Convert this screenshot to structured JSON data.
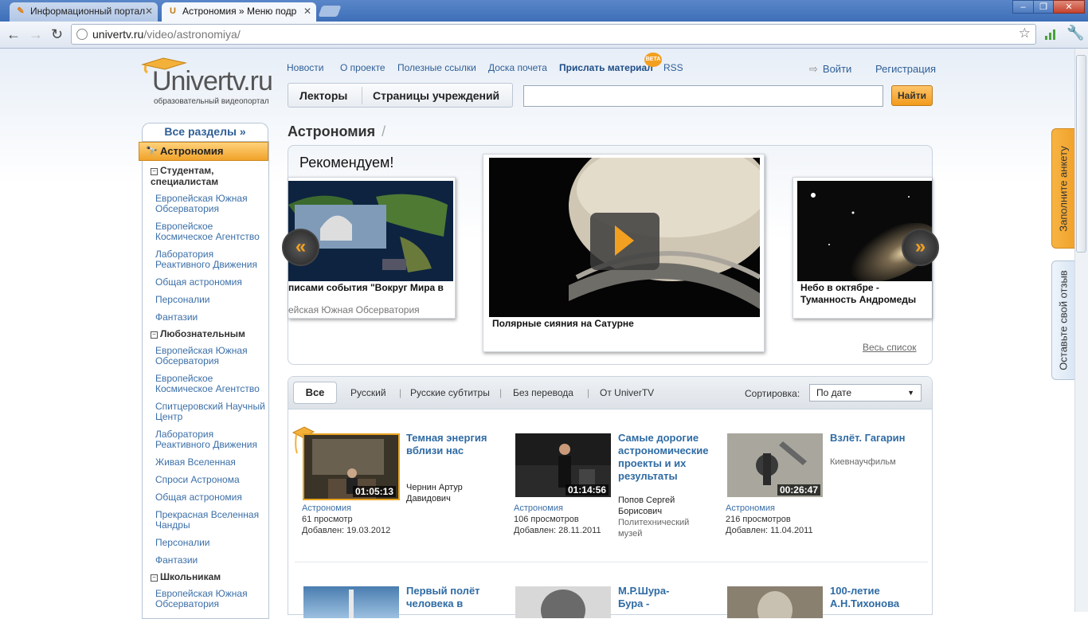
{
  "browser": {
    "tabs": [
      {
        "label": "Информационный портал",
        "favicon": "firefox-like-icon"
      },
      {
        "label": "Астрономия » Меню подр",
        "favicon": "univertv-icon"
      }
    ],
    "url_host": "univertv.ru",
    "url_path": "/video/astronomiya/",
    "window_buttons": [
      "–",
      "❐",
      "✕"
    ]
  },
  "header": {
    "logo_text": "Univertv.ru",
    "logo_subtitle": "образовательный видеопортал",
    "nav": [
      "Новости",
      "О проекте",
      "Полезные ссылки",
      "Доска почета",
      "Прислать материал",
      "RSS"
    ],
    "beta_badge": "BETA",
    "login": "Войти",
    "register": "Регистрация",
    "seg_lecturers": "Лекторы",
    "seg_institutions": "Страницы учреждений",
    "search_value": "",
    "search_button": "Найти"
  },
  "sidebar": {
    "all_sections": "Все разделы »",
    "current": "Астрономия",
    "groups": [
      {
        "title": "Студентам, специалистам",
        "items": [
          "Европейская Южная Обсерватория",
          "Европейское Космическое Агентство",
          "Лаборатория Реактивного Движения",
          "Общая астрономия",
          "Персоналии",
          "Фантазии"
        ]
      },
      {
        "title": "Любознательным",
        "items": [
          "Европейская Южная Обсерватория",
          "Европейское Космическое Агентство",
          "Спитцеровский Научный Центр",
          "Лаборатория Реактивного Движения",
          "Живая Вселенная",
          "Спроси Астронома",
          "Общая астрономия",
          "Прекрасная Вселенная Чандры",
          "Персоналии",
          "Фантазии"
        ]
      },
      {
        "title": "Школьникам",
        "items": [
          "Европейская Южная Обсерватория"
        ]
      }
    ]
  },
  "main": {
    "title": "Астрономия",
    "title_sep": "/",
    "carousel": {
      "heading": "Рекомендуем!",
      "left_caption": "писами события \"Вокруг Мира в",
      "left_sub": "ейская Южная Обсерватория",
      "center_caption": "Полярные сияния на Сатурне",
      "right_caption": "Небо в октябре - Туманность Андромеды",
      "all_list": "Весь список"
    },
    "filters": {
      "active": "Все",
      "options": [
        "Русский",
        "Русские субтитры",
        "Без перевода",
        "От UniverTV"
      ],
      "sort_label": "Сортировка:",
      "sort_value": "По дате"
    },
    "videos": [
      {
        "title": "Темная энергия вблизи нас",
        "duration": "01:05:13",
        "author": "Чернин Артур Давидович",
        "org": "",
        "category": "Астрономия",
        "views": "61 просмотр",
        "added": "Добавлен: 19.03.2012"
      },
      {
        "title": "Самые дорогие астрономические проекты и их результаты",
        "duration": "01:14:56",
        "author": "Попов Сергей Борисович",
        "org": "Политехнический музей",
        "category": "Астрономия",
        "views": "106 просмотров",
        "added": "Добавлен: 28.11.2011"
      },
      {
        "title": "Взлёт. Гагарин",
        "duration": "00:26:47",
        "author": "",
        "org": "Киевнаучфильм",
        "category": "Астрономия",
        "views": "216 просмотров",
        "added": "Добавлен: 11.04.2011"
      }
    ],
    "videos_row2": [
      {
        "title": "Первый полёт человека в"
      },
      {
        "title": "М.Р.Шура-Бура -"
      },
      {
        "title": "100-летие А.Н.Тихонова"
      }
    ]
  },
  "side_tabs": {
    "survey": "Заполните анкету",
    "feedback": "Оставьте свой отзыв"
  }
}
